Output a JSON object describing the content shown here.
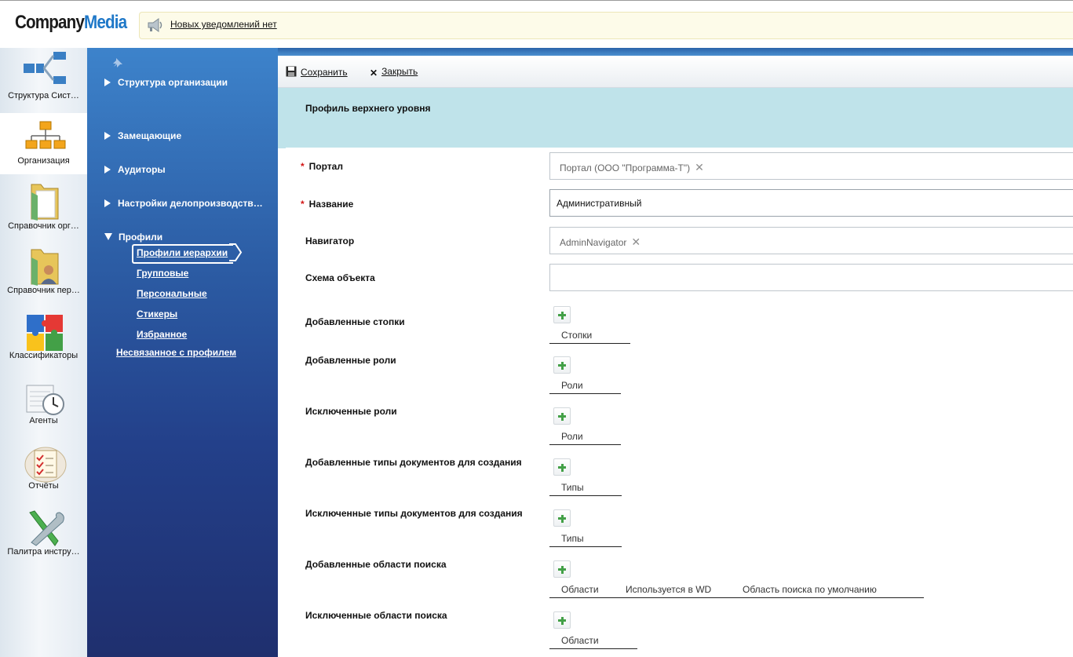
{
  "header": {
    "logo_company": "Company",
    "logo_media": "Media",
    "notification": "Новых уведомлений нет"
  },
  "apps": [
    {
      "label": "Структура Сист…",
      "icon": "system-structure-icon"
    },
    {
      "label": "Организация",
      "icon": "organization-icon",
      "active": true
    },
    {
      "label": "Справочник орг…",
      "icon": "org-directory-folder-icon"
    },
    {
      "label": "Справочник пер…",
      "icon": "people-directory-folder-icon"
    },
    {
      "label": "Классификаторы",
      "icon": "puzzle-icon"
    },
    {
      "label": "Агенты",
      "icon": "clock-calendar-icon"
    },
    {
      "label": "Отчёты",
      "icon": "report-checklist-icon"
    },
    {
      "label": "Палитра инстру…",
      "icon": "tools-icon"
    }
  ],
  "nav": {
    "items": [
      {
        "label": "Структура организации"
      },
      {
        "label": "Замещающие"
      },
      {
        "label": "Аудиторы"
      },
      {
        "label": "Настройки делопроизводств…"
      },
      {
        "label": "Профили"
      }
    ],
    "sub_items": [
      {
        "label": "Профили иерархии",
        "active": true
      },
      {
        "label": "Групповые"
      },
      {
        "label": "Персональные"
      },
      {
        "label": "Стикеры"
      },
      {
        "label": "Избранное"
      }
    ],
    "unlinked": "Несвязанное с профилем"
  },
  "toolbar": {
    "save": "Сохранить",
    "close": "Закрыть"
  },
  "page": {
    "title": "Профиль верхнего уровня"
  },
  "form": {
    "required_mark": "*",
    "portal_label": "Портал",
    "portal_value": "Портал (ООО \"Программа-Т\")",
    "name_label": "Название",
    "name_value": "Административный",
    "navigator_label": "Навигатор",
    "navigator_value": "AdminNavigator",
    "schema_label": "Схема объекта",
    "schema_value": "",
    "clear_glyph": "✕",
    "lists": [
      {
        "label": "Добавленные стопки",
        "columns": [
          "Стопки"
        ]
      },
      {
        "label": "Добавленные роли",
        "columns": [
          "Роли"
        ]
      },
      {
        "label": "Исключенные роли",
        "columns": [
          "Роли"
        ]
      },
      {
        "label": "Добавленные типы документов для создания",
        "columns": [
          "Типы"
        ]
      },
      {
        "label": "Исключенные типы документов для создания",
        "columns": [
          "Типы"
        ]
      },
      {
        "label": "Добавленные области поиска",
        "columns": [
          "Области",
          "Используется в WD",
          "Область поиска по умолчанию"
        ]
      },
      {
        "label": "Исключенные области поиска",
        "columns": [
          "Области"
        ]
      }
    ]
  },
  "colors": {
    "nav_top": "#3d83cb",
    "nav_bottom": "#1f2f6e",
    "title_band": "#bfe3ea",
    "required": "#d21414",
    "add_plus": "#43a047",
    "logo_media": "#1f78c8"
  }
}
